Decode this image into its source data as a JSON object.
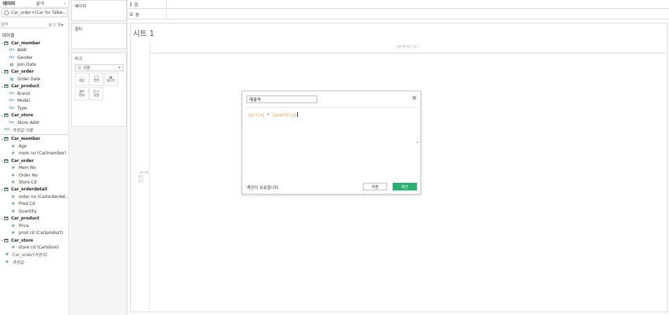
{
  "data_pane": {
    "tabs": [
      "데이터",
      "분석"
    ],
    "collapse_icon": "chevron-left-icon",
    "datasource": "Car_order+(Car for Table...",
    "search_placeholder": "검색",
    "tables_heading": "테이블",
    "rows": [
      {
        "kind": "table",
        "label": "Car_member"
      },
      {
        "kind": "dim",
        "icon": "Abc",
        "label": "Addr"
      },
      {
        "kind": "dim",
        "icon": "Abc",
        "label": "Gender"
      },
      {
        "kind": "date",
        "icon": "calendar",
        "label": "Join Date"
      },
      {
        "kind": "table",
        "label": "Car_order"
      },
      {
        "kind": "date",
        "icon": "calendar",
        "label": "Order Date"
      },
      {
        "kind": "table",
        "label": "Car_product"
      },
      {
        "kind": "dim",
        "icon": "Abc",
        "label": "Brand"
      },
      {
        "kind": "dim",
        "icon": "Abc",
        "label": "Model"
      },
      {
        "kind": "dim",
        "icon": "Abc",
        "label": "Type"
      },
      {
        "kind": "table",
        "label": "Car_store"
      },
      {
        "kind": "dim",
        "icon": "Abc",
        "label": "Store Addr"
      },
      {
        "kind": "top",
        "icon": "Abc",
        "label": "측정값 이름"
      },
      {
        "kind": "sep"
      },
      {
        "kind": "table",
        "label": "Car_member"
      },
      {
        "kind": "measure",
        "icon": "#",
        "label": "Age"
      },
      {
        "kind": "measure",
        "icon": "#",
        "label": "mem no (Carlmember)"
      },
      {
        "kind": "table",
        "label": "Car_order"
      },
      {
        "kind": "measure",
        "icon": "#",
        "label": "Mem No"
      },
      {
        "kind": "measure",
        "icon": "#",
        "label": "Order No"
      },
      {
        "kind": "measure",
        "icon": "#",
        "label": "Store Cd"
      },
      {
        "kind": "table",
        "label": "Car_orderdetail"
      },
      {
        "kind": "measure",
        "icon": "#",
        "label": "order no (Carlorderdet..."
      },
      {
        "kind": "measure",
        "icon": "#",
        "label": "Prod Cd"
      },
      {
        "kind": "measure",
        "icon": "#",
        "label": "Quantity"
      },
      {
        "kind": "table",
        "label": "Car_product"
      },
      {
        "kind": "measure",
        "icon": "#",
        "label": "Price"
      },
      {
        "kind": "measure",
        "icon": "#",
        "label": "prod cd (Carlproduct)"
      },
      {
        "kind": "table",
        "label": "Car_store"
      },
      {
        "kind": "measure",
        "icon": "#",
        "label": "store cd (Carlstore)"
      },
      {
        "kind": "top",
        "icon": "#",
        "label": "Car_order(카운트)"
      },
      {
        "kind": "top",
        "icon": "#",
        "label": "측정값"
      }
    ]
  },
  "cards": {
    "pages": "페이지",
    "filters": "필터",
    "marks": "마크",
    "marks_type": "자동",
    "mark_buttons_row1": [
      "색상",
      "크기",
      "텍스트"
    ],
    "mark_buttons_row2": [
      "세부\n정보",
      "도구\n설명"
    ]
  },
  "shelves": {
    "columns": "열",
    "rows": "행"
  },
  "sheet": {
    "title": "시트 1",
    "drop_columns": "여기에 필드 놓기",
    "drop_rows": "여기에\n필드\n놓기"
  },
  "calc_dialog": {
    "name": "매출액",
    "formula_field1": "[price]",
    "formula_op": " * ",
    "formula_field2": "[quantity]",
    "status": "계산이 유효합니다.",
    "apply_label": "적용",
    "ok_label": "확인",
    "ok_color": "#27b06f"
  }
}
